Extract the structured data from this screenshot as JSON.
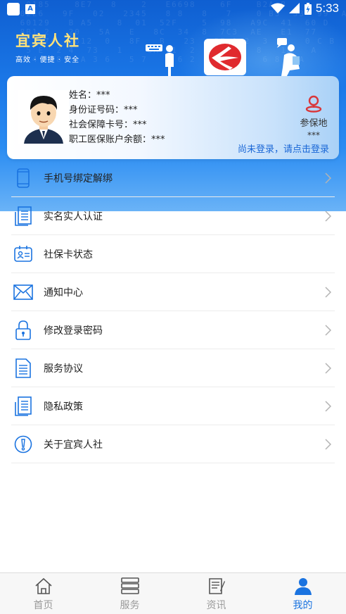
{
  "status_bar": {
    "time": "5:33"
  },
  "brand": {
    "name": "宜宾人社",
    "slogan": "高效 · 便捷 · 安全"
  },
  "card": {
    "name_label": "姓名：***",
    "id_label": "身份证号码：***",
    "card_label": "社会保障卡号：***",
    "balance_label": "职工医保账户余额：***",
    "location_label": "参保地",
    "location_value": "***",
    "login_hint": "尚未登录，请点击登录"
  },
  "menu": [
    {
      "label": "手机号绑定解绑",
      "icon": "phone-icon",
      "chevron": true
    },
    {
      "label": "实名实人认证",
      "icon": "document-icon",
      "chevron": true
    },
    {
      "label": "社保卡状态",
      "icon": "id-card-icon",
      "chevron": false
    },
    {
      "label": "通知中心",
      "icon": "envelope-icon",
      "chevron": true
    },
    {
      "label": "修改登录密码",
      "icon": "lock-icon",
      "chevron": true
    },
    {
      "label": "服务协议",
      "icon": "file-icon",
      "chevron": true
    },
    {
      "label": "隐私政策",
      "icon": "document-icon",
      "chevron": true
    },
    {
      "label": "关于宜宾人社",
      "icon": "info-icon",
      "chevron": true
    }
  ],
  "bottom_nav": [
    {
      "label": "首页",
      "icon": "home-icon",
      "active": false
    },
    {
      "label": "服务",
      "icon": "list-icon",
      "active": false
    },
    {
      "label": "资讯",
      "icon": "news-icon",
      "active": false
    },
    {
      "label": "我的",
      "icon": "user-icon",
      "active": true
    }
  ],
  "colors": {
    "primary": "#1a73e0",
    "banner": "#1b78e8",
    "brand_text": "#ffe27a",
    "location_pin": "#d9373a"
  }
}
